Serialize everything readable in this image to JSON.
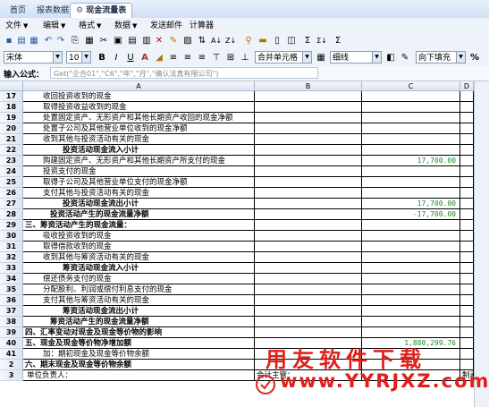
{
  "tabs": [
    {
      "label": "首页"
    },
    {
      "label": "报表数据"
    },
    {
      "label": "现金流量表"
    }
  ],
  "menu": [
    {
      "label": "文件"
    },
    {
      "label": "编辑"
    },
    {
      "label": "格式"
    },
    {
      "label": "数据"
    },
    {
      "label": "发送邮件"
    },
    {
      "label": "计算器"
    }
  ],
  "format_bar": {
    "font": "宋体",
    "size": "10",
    "bold": "B",
    "italic": "I",
    "underline": "U",
    "merge": "合并单元格",
    "border": "细线",
    "fill": "向下填充",
    "percent": "%"
  },
  "formula_bar": {
    "label": "输入公式：",
    "value": "Get(\"企合01\",\"C6\",\"年\",\"月\",\"确认法真有限公司\")"
  },
  "columns": {
    "A": "A",
    "B": "B",
    "C": "C",
    "D": "D"
  },
  "rows": [
    {
      "n": "17",
      "a": "收回投资收到的现金",
      "c": "",
      "style": "i2"
    },
    {
      "n": "18",
      "a": "取得投资收益收到的现金",
      "c": "",
      "style": "i2"
    },
    {
      "n": "19",
      "a": "处置固定资产、无形资产和其他长期资产收回的现金净额",
      "c": "",
      "style": "i2"
    },
    {
      "n": "20",
      "a": "处置子公司及其他营业单位收到的现金净额",
      "c": "",
      "style": "i2"
    },
    {
      "n": "21",
      "a": "收到其他与投资活动有关的现金",
      "c": "",
      "style": "i2"
    },
    {
      "n": "22",
      "a": "投资活动现金流入小计",
      "c": "",
      "style": "b4"
    },
    {
      "n": "23",
      "a": "购建固定资产、无形资产和其他长期资产所支付的现金",
      "c": "17,700.00",
      "style": "i2"
    },
    {
      "n": "24",
      "a": "投资支付的现金",
      "c": "",
      "style": "i2"
    },
    {
      "n": "25",
      "a": "取得子公司及其他营业单位支付的现金净额",
      "c": "",
      "style": "i2"
    },
    {
      "n": "26",
      "a": "支付其他与投资活动有关的现金",
      "c": "",
      "style": "i2"
    },
    {
      "n": "27",
      "a": "投资活动现金流出小计",
      "c": "17,700.00",
      "style": "b4"
    },
    {
      "n": "28",
      "a": "投资活动产生的现金流量净额",
      "c": "-17,700.00",
      "style": "b3"
    },
    {
      "n": "29",
      "a": "三、筹资活动产生的现金流量：",
      "c": "",
      "style": "b0"
    },
    {
      "n": "30",
      "a": "吸收投资收到的现金",
      "c": "",
      "style": "i2"
    },
    {
      "n": "31",
      "a": "取得借款收到的现金",
      "c": "",
      "style": "i2"
    },
    {
      "n": "32",
      "a": "收到其他与筹资活动有关的现金",
      "c": "",
      "style": "i2"
    },
    {
      "n": "33",
      "a": "筹资活动现金流入小计",
      "c": "",
      "style": "b4"
    },
    {
      "n": "34",
      "a": "偿还债务支付的现金",
      "c": "",
      "style": "i2"
    },
    {
      "n": "35",
      "a": "分配股利、利润或偿付利息支付的现金",
      "c": "",
      "style": "i2"
    },
    {
      "n": "36",
      "a": "支付其他与筹资活动有关的现金",
      "c": "",
      "style": "i2"
    },
    {
      "n": "37",
      "a": "筹资活动现金流出小计",
      "c": "",
      "style": "b4"
    },
    {
      "n": "38",
      "a": "筹资活动产生的现金流量净额",
      "c": "",
      "style": "b3"
    },
    {
      "n": "39",
      "a": "四、汇率变动对现金及现金等价物的影响",
      "c": "",
      "style": "b0"
    },
    {
      "n": "40",
      "a": "五、现金及现金等价物净增加额",
      "c": "1,880,299.76",
      "style": "b0"
    },
    {
      "n": "41",
      "a": "加：期初现金及现金等价物余额",
      "c": "",
      "style": "i1"
    },
    {
      "n": "2",
      "a": "六、期末现金及现金等价物余额",
      "c": "",
      "style": "b0"
    },
    {
      "n": "3",
      "a": "单位负责人：",
      "b": "会计主管：",
      "d": "制表人：",
      "c": "",
      "style": "i0"
    }
  ],
  "watermark": {
    "title": "用友软件下载",
    "url": "www.YYRJXZ.com"
  },
  "colors": {
    "accent": "#1a8a2a",
    "brand": "#e0201a"
  }
}
